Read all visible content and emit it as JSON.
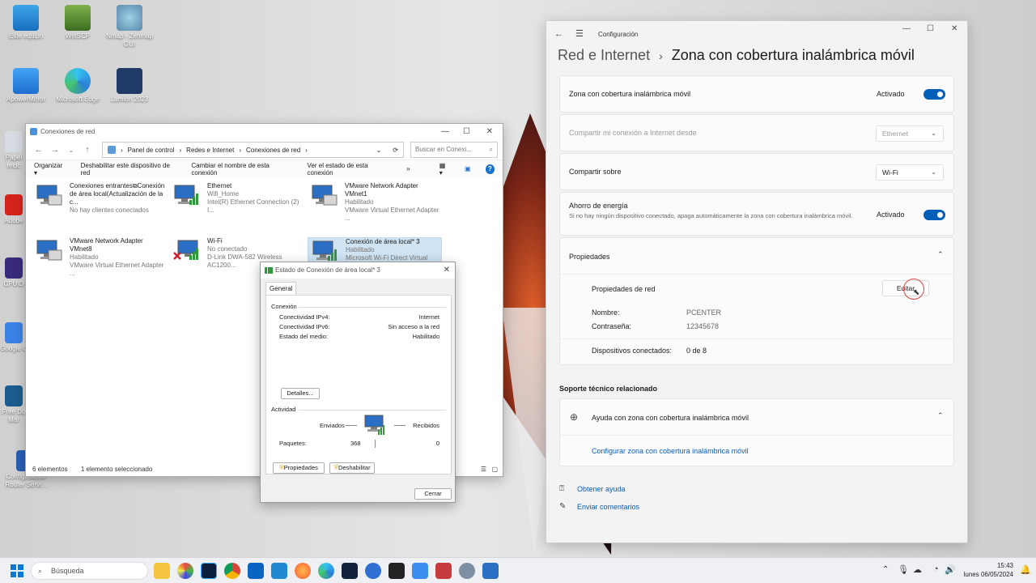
{
  "desktop": {
    "icons": [
      {
        "label": "Este equipo"
      },
      {
        "label": "WinSCP"
      },
      {
        "label": "Nmap - Zenmap GUI"
      },
      {
        "label": "ApowerMirror"
      },
      {
        "label": "Microsoft Edge"
      },
      {
        "label": "Lumion 2023"
      }
    ],
    "left_stubs": [
      "Papel recic",
      "Adobe",
      "CPUID",
      "Google C",
      "Free Do Mar",
      "Configuración Router Servi..."
    ]
  },
  "explorer": {
    "title": "Conexiones de red",
    "breadcrumb": [
      "Panel de control",
      "Redes e Internet",
      "Conexiones de red"
    ],
    "search_placeholder": "Buscar en Conexi...",
    "commands": [
      "Organizar ▾",
      "Deshabilitar este dispositivo de red",
      "Cambiar el nombre de esta conexión",
      "Ver el estado de esta conexión",
      "»"
    ],
    "items": [
      {
        "name": "Conexiones entrantes⧉Conexión de área local(Actualización de la c...",
        "line2": "No hay clientes conectados",
        "line3": ""
      },
      {
        "name": "Ethernet",
        "line2": "Wifi_Home",
        "line3": "Intel(R) Ethernet Connection (2) I..."
      },
      {
        "name": "VMware Network Adapter VMnet1",
        "line2": "Habilitado",
        "line3": "VMware Virtual Ethernet Adapter ..."
      },
      {
        "name": "VMware Network Adapter VMnet8",
        "line2": "Habilitado",
        "line3": "VMware Virtual Ethernet Adapter ..."
      },
      {
        "name": "Wi-Fi",
        "line2": "No conectado",
        "line3": "D-Link DWA-582 Wireless AC1200..."
      },
      {
        "name": "Conexión de área local* 3",
        "line2": "Habilitado",
        "line3": "Microsoft Wi-Fi Direct Virtual Ada..."
      }
    ],
    "status_count": "6 elementos",
    "status_selected": "1 elemento seleccionado"
  },
  "dialog": {
    "title": "Estado de Conexión de área local* 3",
    "tab": "General",
    "connection_header": "Conexión",
    "rows": [
      {
        "label": "Conectividad IPv4:",
        "value": "Internet"
      },
      {
        "label": "Conectividad IPv6:",
        "value": "Sin acceso a la red"
      },
      {
        "label": "Estado del medio:",
        "value": "Habilitado"
      }
    ],
    "details_button": "Detalles...",
    "activity_header": "Actividad",
    "sent_label": "Enviados",
    "received_label": "Recibidos",
    "packets_label": "Paquetes:",
    "packets_sent": "368",
    "packets_received": "0",
    "properties_button": "Propiedades",
    "disable_button": "Deshabilitar",
    "close_button": "Cerrar"
  },
  "settings": {
    "app_title": "Configuración",
    "breadcrumb_parent": "Red e Internet",
    "page_title": "Zona con cobertura inalámbrica móvil",
    "hotspot_label": "Zona con cobertura inalámbrica móvil",
    "hotspot_state": "Activado",
    "share_from_label": "Compartir mi conexión a Internet desde",
    "share_from_value": "Ethernet",
    "share_over_label": "Compartir sobre",
    "share_over_value": "Wi-Fi",
    "power_saving_label": "Ahorro de energía",
    "power_saving_desc": "Si no hay ningún dispositivo conectado, apaga automáticamente la zona con cobertura inalámbrica móvil.",
    "power_saving_state": "Activado",
    "properties_header": "Propiedades",
    "network_props_label": "Propiedades de red",
    "edit_button": "Editar",
    "name_label": "Nombre:",
    "name_value": "PCENTER",
    "password_label": "Contraseña:",
    "password_value": "12345678",
    "devices_label": "Dispositivos conectados:",
    "devices_value": "0 de 8",
    "support_header": "Soporte técnico relacionado",
    "help_label": "Ayuda con zona con cobertura inalámbrica móvil",
    "help_link": "Configurar zona con cobertura inalámbrica móvil",
    "get_help": "Obtener ayuda",
    "feedback": "Enviar comentarios"
  },
  "taskbar": {
    "search_placeholder": "Búsqueda",
    "time": "15:43",
    "date": "lunes 06/05/2024"
  },
  "colors": {
    "accent": "#005fb8",
    "link": "#0a5cb8"
  }
}
